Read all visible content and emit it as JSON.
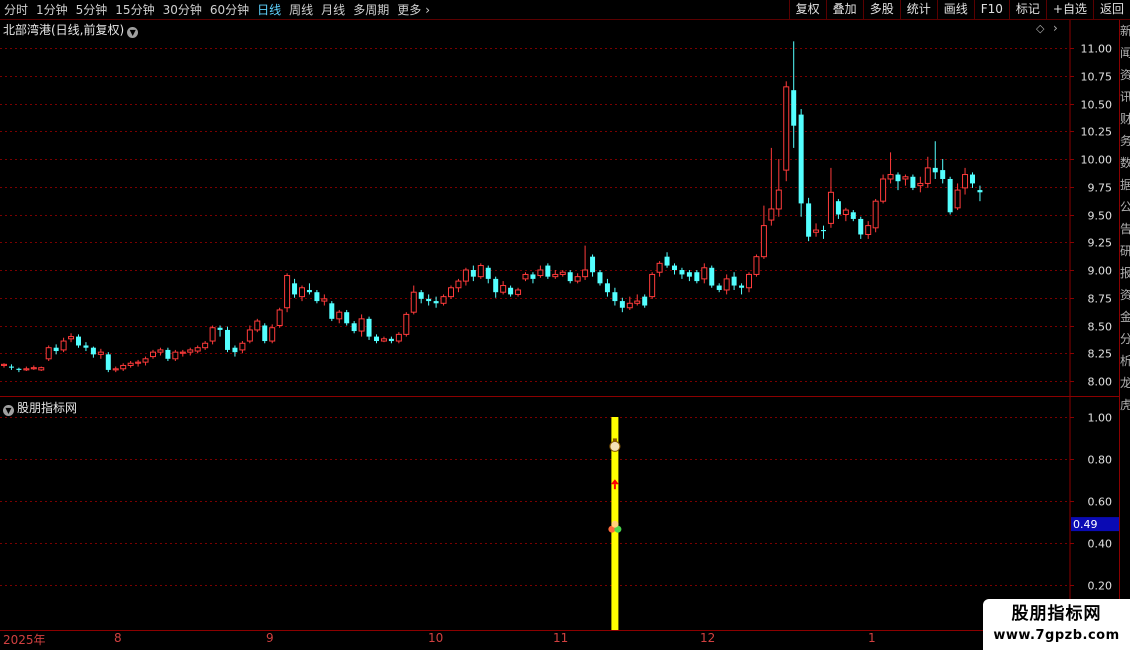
{
  "toolbar": {
    "periods": [
      {
        "label": "分时",
        "active": false
      },
      {
        "label": "1分钟",
        "active": false
      },
      {
        "label": "5分钟",
        "active": false
      },
      {
        "label": "15分钟",
        "active": false
      },
      {
        "label": "30分钟",
        "active": false
      },
      {
        "label": "60分钟",
        "active": false
      },
      {
        "label": "日线",
        "active": true
      },
      {
        "label": "周线",
        "active": false
      },
      {
        "label": "月线",
        "active": false
      },
      {
        "label": "多周期",
        "active": false
      },
      {
        "label": "更多",
        "active": false
      }
    ],
    "buttons": [
      "复权",
      "叠加",
      "多股",
      "统计",
      "画线",
      "F10",
      "标记",
      "+自选",
      "返回"
    ]
  },
  "stock_title": "北部湾港(日线,前复权)",
  "indicator_title": "股朋指标网",
  "date_labels": [
    "2025年",
    "8",
    "9",
    "10",
    "11",
    "12",
    "1"
  ],
  "side_strip_text": "新闻资讯财务数据公告研报资金分析龙虎",
  "watermark": {
    "line1": "股朋指标网",
    "line2": "www.7gpzb.com"
  },
  "colors": {
    "up": "#ff3b3b",
    "down": "#54ffff",
    "grid": "#7a0000",
    "border": "#8b0000",
    "indicator_bar": "#ffff00"
  },
  "icons": {
    "collapse_title": "chevron-down-icon",
    "diamond": "diamond-icon",
    "nav": "chevron-right-icon"
  },
  "chart_data": [
    {
      "type": "candlestick",
      "title": "北部湾港(日线,前复权)",
      "ylim": [
        7.9,
        11.1
      ],
      "y_ticks": [
        "11.00",
        "10.75",
        "10.50",
        "10.25",
        "10.00",
        "9.75",
        "9.50",
        "9.25",
        "9.00",
        "8.75",
        "8.50",
        "8.25",
        "8.00"
      ],
      "x_labels": [
        "2025年",
        "8",
        "9",
        "10",
        "11",
        "12",
        "1"
      ],
      "candles": [
        [
          8.14,
          8.15,
          8.12,
          8.16
        ],
        [
          8.13,
          8.12,
          8.1,
          8.15
        ],
        [
          8.11,
          8.1,
          8.08,
          8.12
        ],
        [
          8.1,
          8.11,
          8.09,
          8.13
        ],
        [
          8.11,
          8.12,
          8.1,
          8.14
        ],
        [
          8.1,
          8.12,
          8.09,
          8.13
        ],
        [
          8.2,
          8.3,
          8.18,
          8.32
        ],
        [
          8.3,
          8.27,
          8.24,
          8.33
        ],
        [
          8.28,
          8.36,
          8.26,
          8.39
        ],
        [
          8.38,
          8.4,
          8.35,
          8.43
        ],
        [
          8.4,
          8.32,
          8.3,
          8.42
        ],
        [
          8.32,
          8.3,
          8.27,
          8.35
        ],
        [
          8.3,
          8.24,
          8.21,
          8.31
        ],
        [
          8.24,
          8.26,
          8.2,
          8.29
        ],
        [
          8.24,
          8.1,
          8.08,
          8.26
        ],
        [
          8.1,
          8.11,
          8.08,
          8.13
        ],
        [
          8.11,
          8.14,
          8.09,
          8.16
        ],
        [
          8.14,
          8.16,
          8.12,
          8.18
        ],
        [
          8.16,
          8.17,
          8.13,
          8.19
        ],
        [
          8.17,
          8.2,
          8.14,
          8.22
        ],
        [
          8.22,
          8.26,
          8.2,
          8.28
        ],
        [
          8.26,
          8.28,
          8.23,
          8.3
        ],
        [
          8.28,
          8.2,
          8.18,
          8.3
        ],
        [
          8.2,
          8.26,
          8.18,
          8.28
        ],
        [
          8.25,
          8.26,
          8.22,
          8.28
        ],
        [
          8.26,
          8.28,
          8.23,
          8.3
        ],
        [
          8.27,
          8.3,
          8.25,
          8.32
        ],
        [
          8.3,
          8.34,
          8.28,
          8.36
        ],
        [
          8.36,
          8.48,
          8.33,
          8.5
        ],
        [
          8.48,
          8.46,
          8.4,
          8.5
        ],
        [
          8.46,
          8.28,
          8.26,
          8.49
        ],
        [
          8.3,
          8.26,
          8.22,
          8.32
        ],
        [
          8.28,
          8.34,
          8.25,
          8.36
        ],
        [
          8.36,
          8.46,
          8.34,
          8.5
        ],
        [
          8.46,
          8.54,
          8.44,
          8.56
        ],
        [
          8.5,
          8.36,
          8.34,
          8.52
        ],
        [
          8.36,
          8.48,
          8.34,
          8.51
        ],
        [
          8.5,
          8.64,
          8.48,
          8.66
        ],
        [
          8.66,
          8.95,
          8.62,
          8.97
        ],
        [
          8.88,
          8.78,
          8.75,
          8.92
        ],
        [
          8.76,
          8.84,
          8.72,
          8.86
        ],
        [
          8.82,
          8.8,
          8.78,
          8.88
        ],
        [
          8.8,
          8.72,
          8.7,
          8.82
        ],
        [
          8.72,
          8.74,
          8.68,
          8.78
        ],
        [
          8.7,
          8.56,
          8.54,
          8.72
        ],
        [
          8.56,
          8.62,
          8.52,
          8.64
        ],
        [
          8.62,
          8.52,
          8.5,
          8.64
        ],
        [
          8.52,
          8.45,
          8.43,
          8.54
        ],
        [
          8.45,
          8.56,
          8.4,
          8.6
        ],
        [
          8.56,
          8.4,
          8.37,
          8.58
        ],
        [
          8.4,
          8.36,
          8.34,
          8.42
        ],
        [
          8.36,
          8.38,
          8.35,
          8.4
        ],
        [
          8.38,
          8.36,
          8.34,
          8.4
        ],
        [
          8.36,
          8.42,
          8.34,
          8.44
        ],
        [
          8.42,
          8.6,
          8.4,
          8.62
        ],
        [
          8.62,
          8.8,
          8.6,
          8.86
        ],
        [
          8.8,
          8.74,
          8.7,
          8.82
        ],
        [
          8.74,
          8.72,
          8.68,
          8.78
        ],
        [
          8.72,
          8.7,
          8.66,
          8.76
        ],
        [
          8.7,
          8.76,
          8.68,
          8.78
        ],
        [
          8.76,
          8.84,
          8.74,
          8.86
        ],
        [
          8.84,
          8.9,
          8.8,
          8.92
        ],
        [
          8.9,
          9.0,
          8.86,
          9.02
        ],
        [
          9.0,
          8.94,
          8.9,
          9.04
        ],
        [
          8.94,
          9.04,
          8.92,
          9.06
        ],
        [
          9.02,
          8.92,
          8.88,
          9.04
        ],
        [
          8.92,
          8.8,
          8.75,
          8.94
        ],
        [
          8.8,
          8.86,
          8.78,
          8.9
        ],
        [
          8.84,
          8.78,
          8.76,
          8.86
        ],
        [
          8.78,
          8.82,
          8.76,
          8.84
        ],
        [
          8.92,
          8.96,
          8.9,
          8.98
        ],
        [
          8.96,
          8.92,
          8.88,
          8.98
        ],
        [
          8.95,
          9.0,
          8.93,
          9.04
        ],
        [
          9.04,
          8.94,
          8.92,
          9.06
        ],
        [
          8.94,
          8.96,
          8.92,
          9.0
        ],
        [
          8.96,
          8.98,
          8.94,
          9.0
        ],
        [
          8.98,
          8.9,
          8.88,
          9.0
        ],
        [
          8.9,
          8.94,
          8.88,
          8.97
        ],
        [
          8.94,
          9.0,
          8.91,
          9.22
        ],
        [
          9.12,
          8.98,
          8.94,
          9.14
        ],
        [
          8.98,
          8.88,
          8.86,
          9.0
        ],
        [
          8.88,
          8.8,
          8.76,
          8.92
        ],
        [
          8.8,
          8.72,
          8.68,
          8.84
        ],
        [
          8.72,
          8.66,
          8.62,
          8.75
        ],
        [
          8.66,
          8.7,
          8.64,
          8.76
        ],
        [
          8.7,
          8.72,
          8.68,
          8.78
        ],
        [
          8.76,
          8.68,
          8.66,
          8.78
        ],
        [
          8.76,
          8.96,
          8.74,
          8.98
        ],
        [
          8.98,
          9.06,
          8.94,
          9.08
        ],
        [
          9.12,
          9.04,
          9.02,
          9.16
        ],
        [
          9.04,
          9.0,
          8.96,
          9.06
        ],
        [
          9.0,
          8.96,
          8.92,
          9.02
        ],
        [
          8.98,
          8.94,
          8.9,
          9.0
        ],
        [
          8.98,
          8.9,
          8.88,
          9.0
        ],
        [
          8.92,
          9.02,
          8.88,
          9.06
        ],
        [
          9.02,
          8.86,
          8.84,
          9.04
        ],
        [
          8.86,
          8.82,
          8.8,
          8.88
        ],
        [
          8.82,
          8.92,
          8.78,
          8.96
        ],
        [
          8.94,
          8.86,
          8.82,
          8.98
        ],
        [
          8.86,
          8.84,
          8.78,
          8.88
        ],
        [
          8.84,
          8.96,
          8.8,
          8.98
        ],
        [
          8.96,
          9.12,
          8.94,
          9.14
        ],
        [
          9.12,
          9.4,
          9.1,
          9.58
        ],
        [
          9.45,
          9.55,
          9.4,
          10.1
        ],
        [
          9.55,
          9.72,
          9.48,
          10.0
        ],
        [
          9.9,
          10.65,
          9.8,
          10.7
        ],
        [
          10.62,
          10.3,
          10.1,
          11.06
        ],
        [
          10.4,
          9.6,
          9.48,
          10.45
        ],
        [
          9.6,
          9.3,
          9.26,
          9.65
        ],
        [
          9.34,
          9.36,
          9.3,
          9.42
        ],
        [
          9.36,
          9.35,
          9.28,
          9.4
        ],
        [
          9.42,
          9.7,
          9.38,
          9.92
        ],
        [
          9.62,
          9.5,
          9.46,
          9.64
        ],
        [
          9.5,
          9.54,
          9.44,
          9.56
        ],
        [
          9.52,
          9.46,
          9.44,
          9.54
        ],
        [
          9.46,
          9.32,
          9.28,
          9.48
        ],
        [
          9.32,
          9.4,
          9.28,
          9.44
        ],
        [
          9.38,
          9.62,
          9.34,
          9.64
        ],
        [
          9.62,
          9.82,
          9.6,
          9.86
        ],
        [
          9.82,
          9.86,
          9.78,
          10.06
        ],
        [
          9.86,
          9.8,
          9.72,
          9.88
        ],
        [
          9.82,
          9.84,
          9.76,
          9.86
        ],
        [
          9.84,
          9.74,
          9.72,
          9.86
        ],
        [
          9.76,
          9.78,
          9.7,
          9.84
        ],
        [
          9.78,
          9.92,
          9.74,
          10.02
        ],
        [
          9.92,
          9.88,
          9.82,
          10.16
        ],
        [
          9.9,
          9.82,
          9.78,
          10.0
        ],
        [
          9.82,
          9.52,
          9.5,
          9.84
        ],
        [
          9.56,
          9.72,
          9.54,
          9.78
        ],
        [
          9.74,
          9.86,
          9.68,
          9.92
        ],
        [
          9.86,
          9.78,
          9.74,
          9.88
        ],
        [
          9.72,
          9.7,
          9.62,
          9.76
        ]
      ]
    },
    {
      "type": "bar",
      "title": "股朋指标网",
      "ylim": [
        0.1,
        1.05
      ],
      "y_ticks": [
        "1.00",
        "0.80",
        "0.60",
        "0.40",
        "0.20"
      ],
      "current_value_label": "0.49",
      "current_value": 0.49,
      "bars": [
        {
          "index": 82,
          "value": 1.0,
          "color": "#ffff00"
        }
      ],
      "markers": [
        {
          "index": 82,
          "value": 0.86,
          "kind": "money-bag"
        },
        {
          "index": 82,
          "value": 0.68,
          "kind": "up-arrow"
        },
        {
          "index": 82,
          "value": 0.48,
          "kind": "dots"
        }
      ]
    }
  ]
}
